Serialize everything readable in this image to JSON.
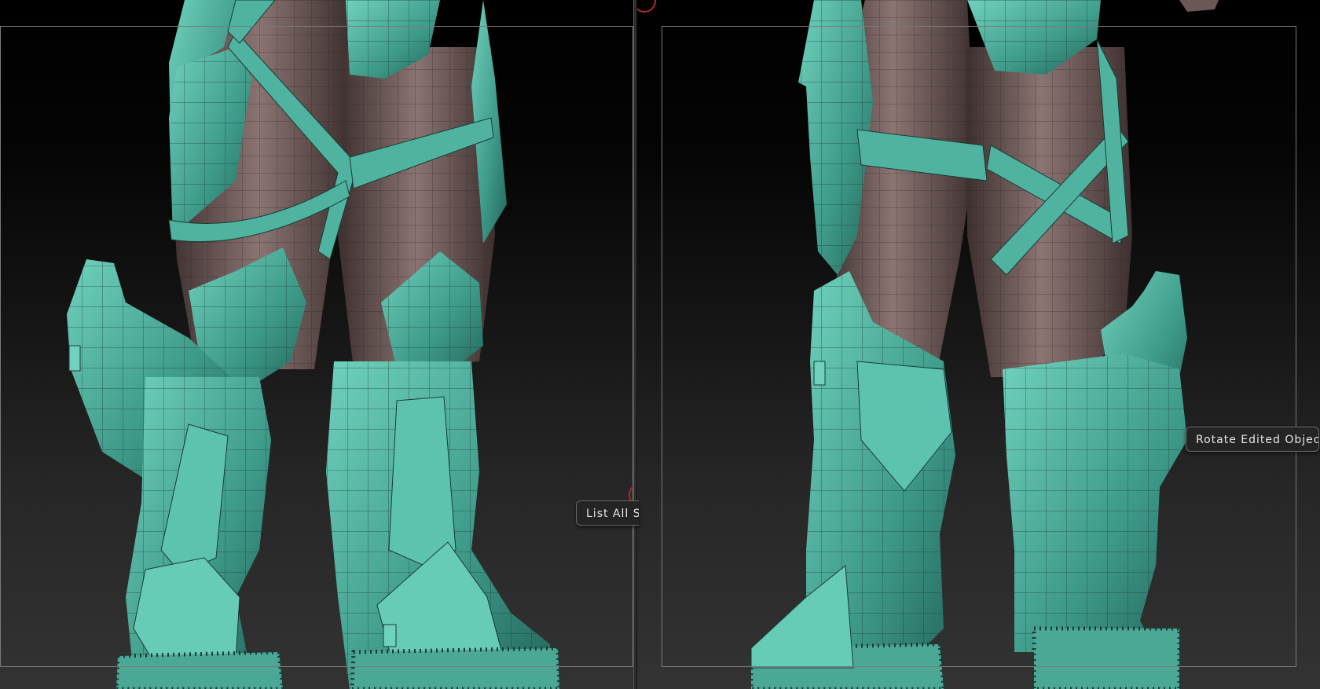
{
  "tooltips": {
    "left": "List All S",
    "right": "Rotate Edited Object"
  },
  "colors": {
    "armor": "#4fb3a0",
    "armor_dark": "#2f7d6f",
    "armor_light": "#6fd2bd",
    "skin": "#7a6563",
    "skin_dark": "#4a3a39",
    "wire": "#1c3a34",
    "cursor": "#b3262a"
  },
  "icons": {
    "brush_cursor": "red-circle-cursor-icon"
  }
}
